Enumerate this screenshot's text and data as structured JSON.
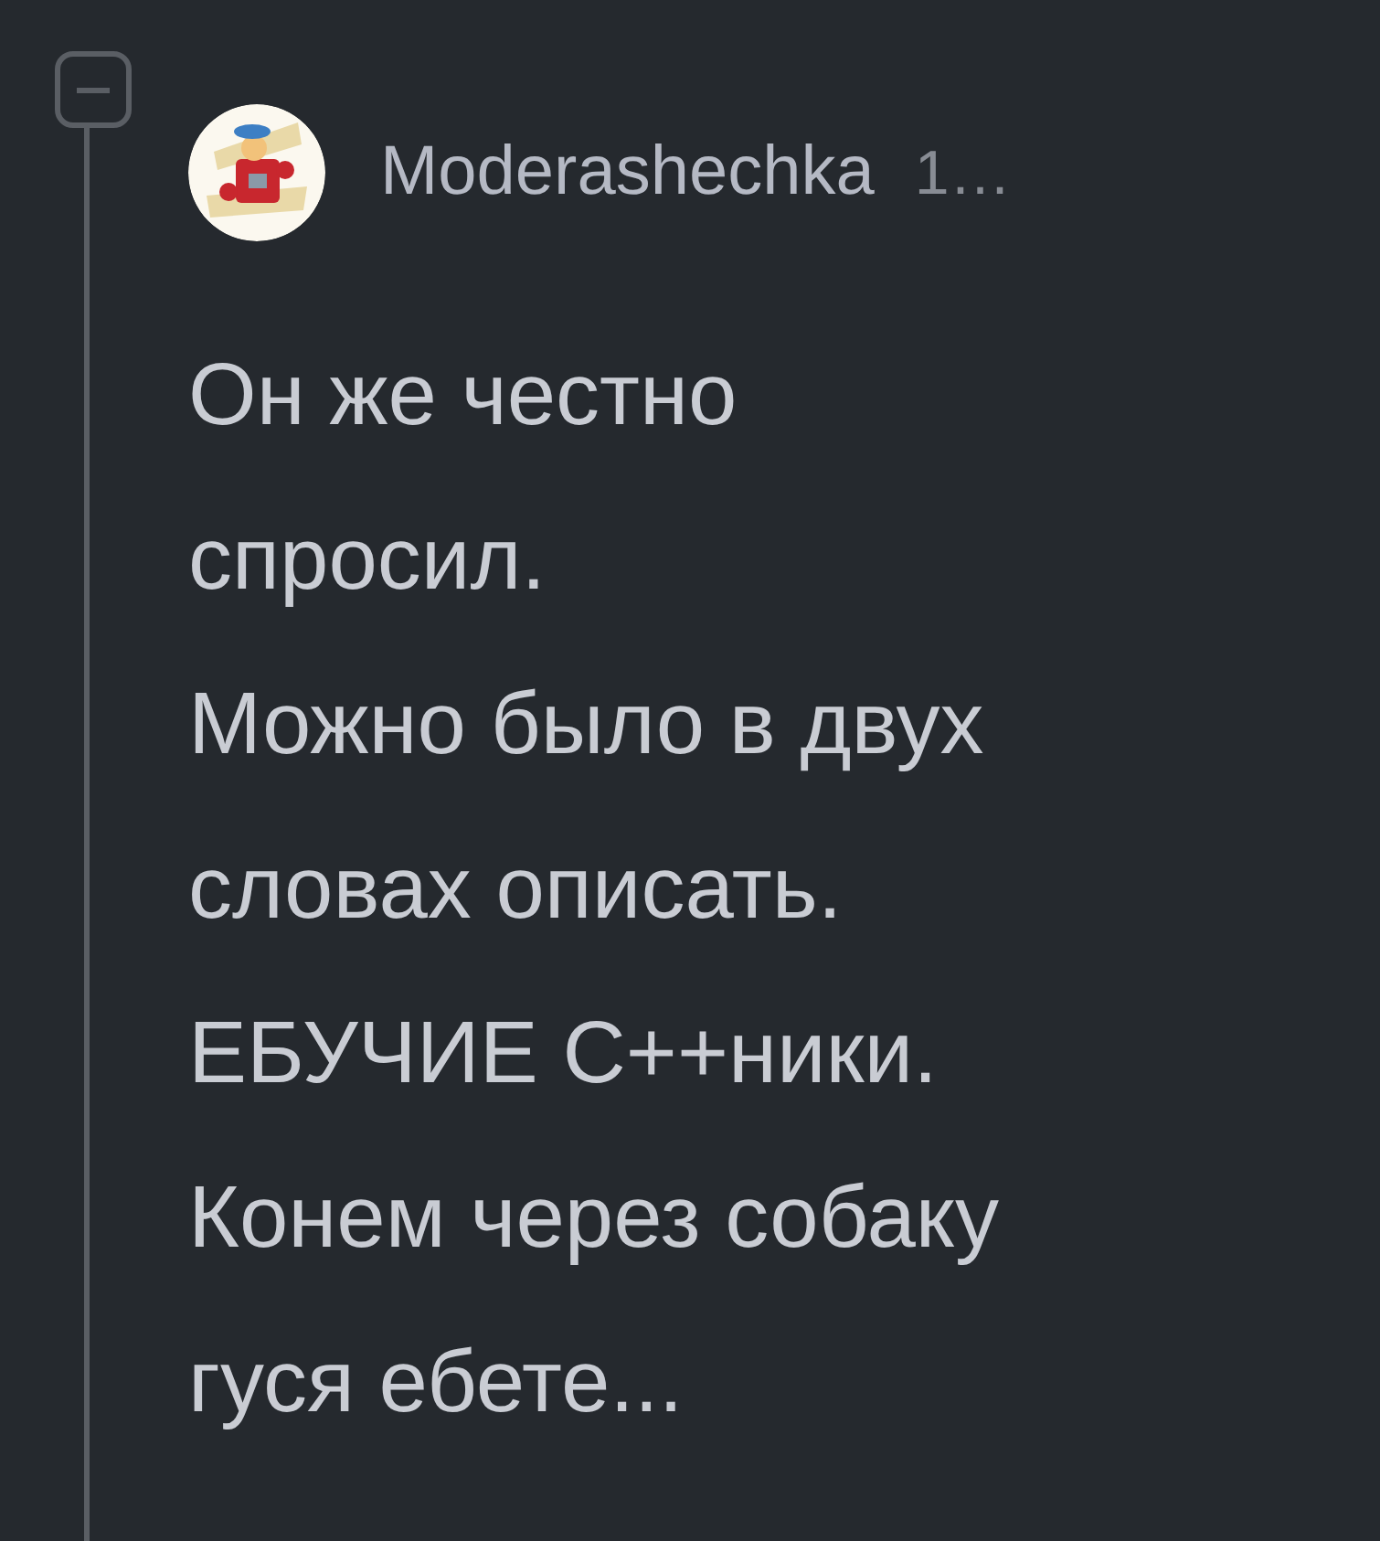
{
  "comment": {
    "author": "Moderashechka",
    "time": "1…",
    "collapsed": false,
    "lines": [
      "Он же честно",
      "спросил.",
      "Можно было в двух",
      "словах описать.",
      "ЕБУЧИЕ С++ники.",
      "Конем через собаку",
      "гуся ебете..."
    ]
  }
}
